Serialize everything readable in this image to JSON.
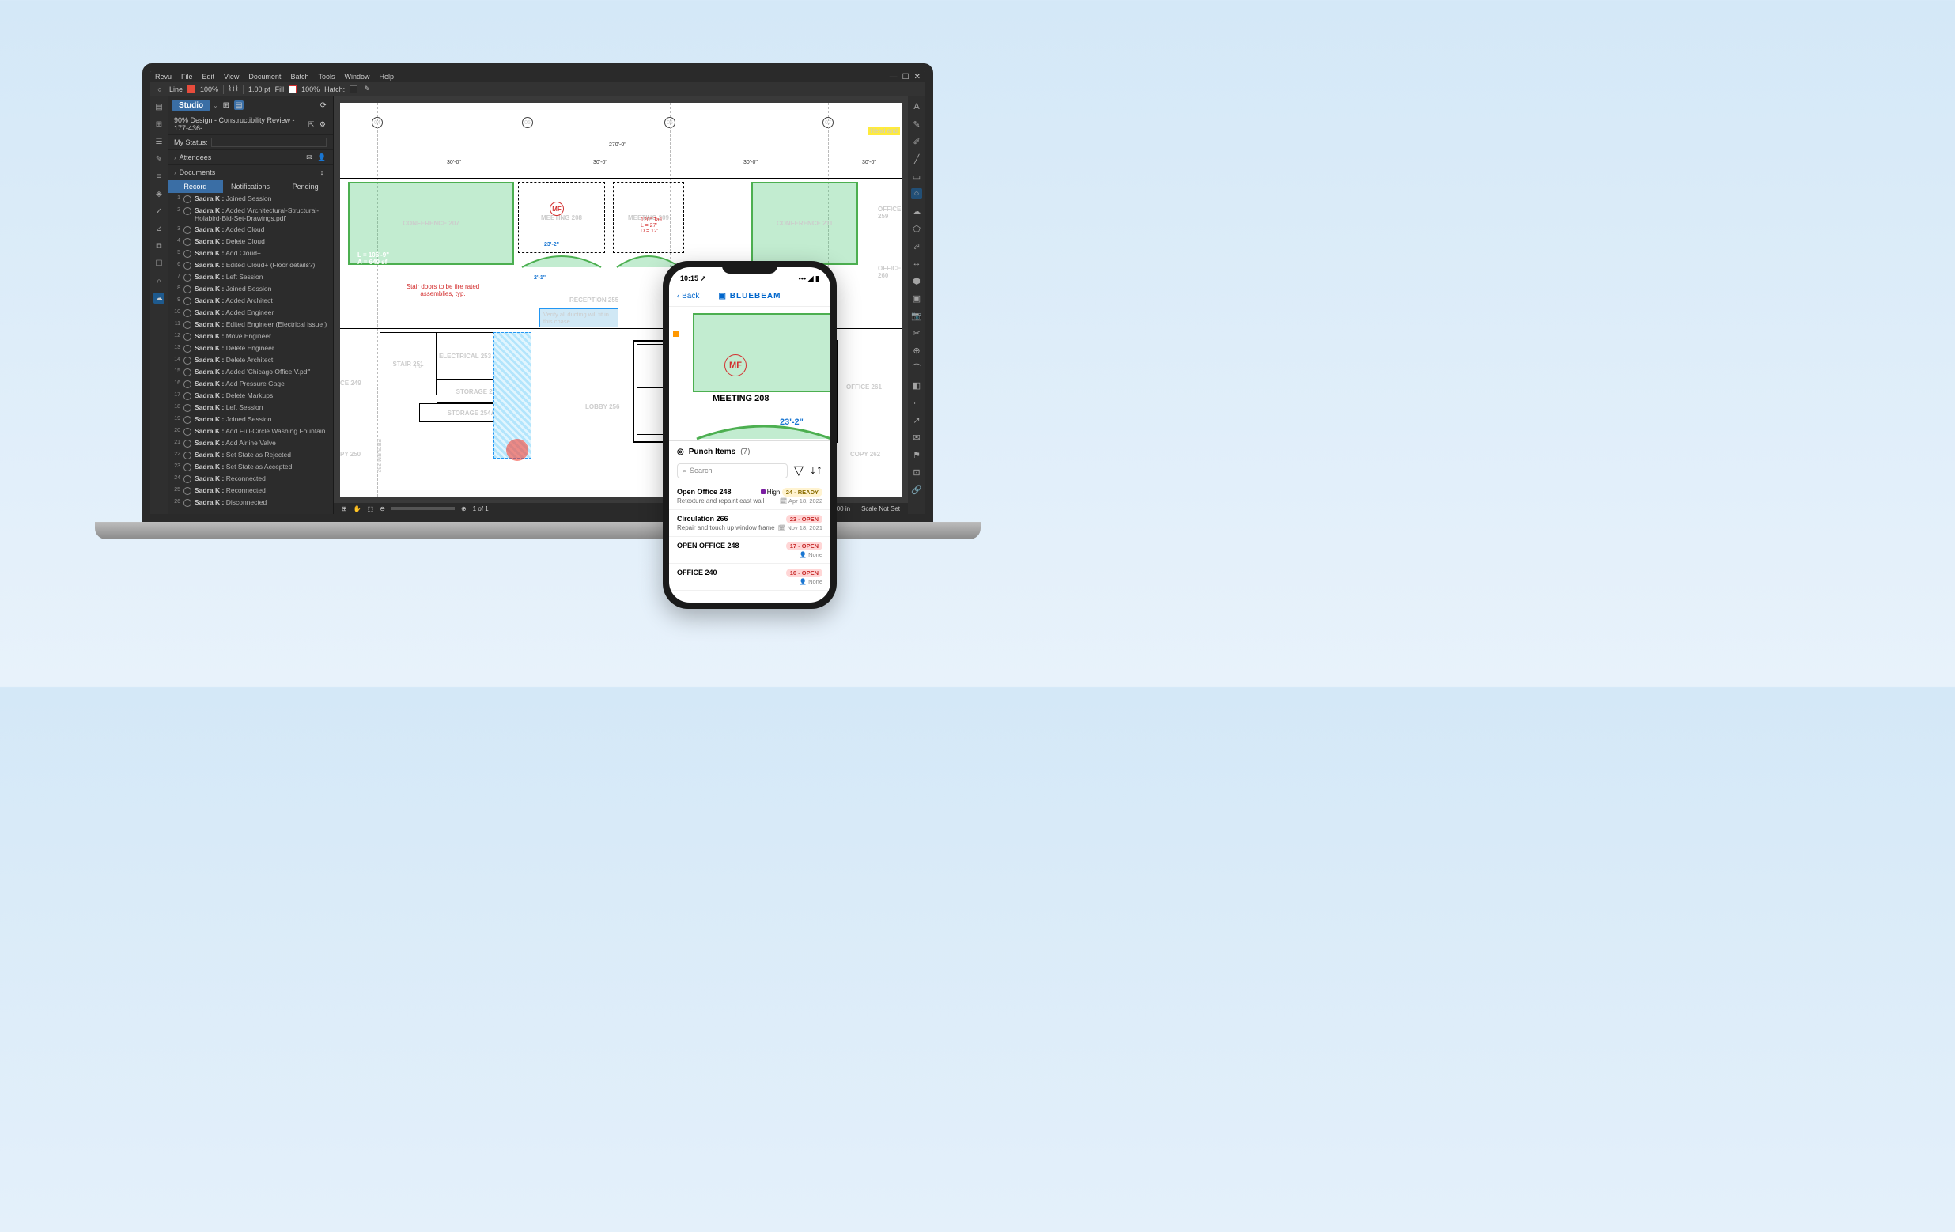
{
  "menu": {
    "items": [
      "Revu",
      "File",
      "Edit",
      "View",
      "Document",
      "Batch",
      "Tools",
      "Window",
      "Help"
    ]
  },
  "toolbar": {
    "line_label": "Line",
    "opacity1": "100%",
    "width_label": "1.00 pt",
    "fill_label": "Fill",
    "opacity2": "100%",
    "hatch_label": "Hatch:"
  },
  "sidebar": {
    "studio": "Studio",
    "session_name": "90% Design - Constructibility Review - 177-436-",
    "my_status": "My Status:",
    "attendees": "Attendees",
    "documents": "Documents",
    "tabs": {
      "record": "Record",
      "notifications": "Notifications",
      "pending": "Pending"
    }
  },
  "records": [
    {
      "n": "1",
      "user": "Sadra K :",
      "action": "Joined Session"
    },
    {
      "n": "2",
      "user": "Sadra K :",
      "action": "Added 'Architectural-Structural-Holabird-Bid-Set-Drawings.pdf'"
    },
    {
      "n": "3",
      "user": "Sadra K :",
      "action": "Added Cloud"
    },
    {
      "n": "4",
      "user": "Sadra K :",
      "action": "Delete Cloud"
    },
    {
      "n": "5",
      "user": "Sadra K :",
      "action": "Add Cloud+"
    },
    {
      "n": "6",
      "user": "Sadra K :",
      "action": "Edited Cloud+ (Floor details?)"
    },
    {
      "n": "7",
      "user": "Sadra K :",
      "action": "Left Session"
    },
    {
      "n": "8",
      "user": "Sadra K :",
      "action": "Joined Session"
    },
    {
      "n": "9",
      "user": "Sadra K :",
      "action": "Added Architect"
    },
    {
      "n": "10",
      "user": "Sadra K :",
      "action": "Added Engineer"
    },
    {
      "n": "11",
      "user": "Sadra K :",
      "action": "Edited Engineer (Electrical issue )"
    },
    {
      "n": "12",
      "user": "Sadra K :",
      "action": "Move Engineer"
    },
    {
      "n": "13",
      "user": "Sadra K :",
      "action": "Delete Engineer"
    },
    {
      "n": "14",
      "user": "Sadra K :",
      "action": "Delete Architect"
    },
    {
      "n": "15",
      "user": "Sadra K :",
      "action": "Added 'Chicago Office V.pdf'"
    },
    {
      "n": "16",
      "user": "Sadra K :",
      "action": "Add Pressure Gage"
    },
    {
      "n": "17",
      "user": "Sadra K :",
      "action": "Delete Markups"
    },
    {
      "n": "18",
      "user": "Sadra K :",
      "action": "Left Session"
    },
    {
      "n": "19",
      "user": "Sadra K :",
      "action": "Joined Session"
    },
    {
      "n": "20",
      "user": "Sadra K :",
      "action": "Add Full-Circle Washing Fountain"
    },
    {
      "n": "21",
      "user": "Sadra K :",
      "action": "Add Airline Valve"
    },
    {
      "n": "22",
      "user": "Sadra K :",
      "action": "Set State as Rejected"
    },
    {
      "n": "23",
      "user": "Sadra K :",
      "action": "Set State as Accepted"
    },
    {
      "n": "24",
      "user": "Sadra K :",
      "action": "Reconnected"
    },
    {
      "n": "25",
      "user": "Sadra K :",
      "action": "Reconnected"
    },
    {
      "n": "26",
      "user": "Sadra K :",
      "action": "Disconnected"
    }
  ],
  "plan": {
    "grid": [
      "04",
      "05",
      "06",
      "07"
    ],
    "overall_dim": "270'-0\"",
    "bay_dim": "30'-0\"",
    "area_label": "L = 106'-9\"\nA = 649 sf",
    "conf_207": "CONFERENCE  207",
    "meeting_208": "MEETING 208",
    "meeting_208_dim": "23'-2\"",
    "meeting_209": "MEETING 209",
    "meeting_209_note": "120° Tall\nL = 27'\nD = 12'",
    "conf_211": "CONFERENCE 211",
    "office_259": "OFFICE 259",
    "office_260": "OFFICE 260",
    "office_261": "OFFICE 261",
    "copy_262": "COPY 262",
    "reception": "RECEPTION 255",
    "lobby": "LOBBY 256",
    "stair_251": "STAIR 251",
    "electrical_253": "ELECTRICAL 253",
    "storage_253a": "STORAGE 253A",
    "storage_254a": "STORAGE 254A",
    "ce_249": "CE  249",
    "py_250": "PY 250",
    "ers_252": "ER'S RM 252",
    "up_label": "UP",
    "red_note": "Stair doors to be fire rated assemblies, typ.",
    "blue_note": "Verify all ducting will fit in this chase",
    "highlight_text": "Head and",
    "dim_2_1": "2'-1\"",
    "mf": "MF"
  },
  "status": {
    "page": "1 of 1",
    "measure": "11.00 in",
    "scale": "Scale Not Set"
  },
  "phone": {
    "time": "10:15",
    "back": "Back",
    "logo": "BLUEBEAM",
    "punch_title": "Punch Items",
    "punch_count": "(7)",
    "search_placeholder": "Search",
    "items": [
      {
        "title": "Open Office 248",
        "priority": "High",
        "badge": "24 - READY",
        "badge_type": "ready",
        "desc": "Retexture and repaint east wall",
        "date": "Apr 18, 2022"
      },
      {
        "title": "Circulation 266",
        "badge": "23 - OPEN",
        "badge_type": "open",
        "desc": "Repair and touch up window frame",
        "date": "Nov 18, 2021"
      },
      {
        "title": "OPEN OFFICE 248",
        "badge": "17 - OPEN",
        "badge_type": "open",
        "meta_right": "None"
      },
      {
        "title": "OFFICE 240",
        "badge": "16 - OPEN",
        "badge_type": "open",
        "meta_right": "None"
      }
    ],
    "plan": {
      "meeting_208": "MEETING 208",
      "dim": "23'-2\"",
      "mf": "MF"
    }
  }
}
